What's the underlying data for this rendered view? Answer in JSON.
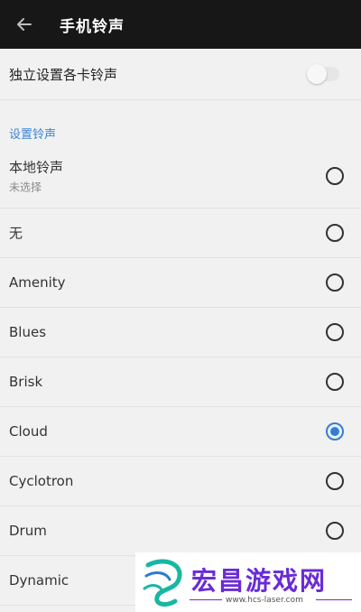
{
  "header": {
    "back_icon": "arrow-left-icon",
    "title": "手机铃声"
  },
  "card_setting": {
    "label": "独立设置各卡铃声",
    "enabled": false
  },
  "section": {
    "title": "设置铃声"
  },
  "ringtones": [
    {
      "title": "本地铃声",
      "subtitle": "未选择",
      "selected": false
    },
    {
      "title": "无",
      "selected": false
    },
    {
      "title": "Amenity",
      "selected": false
    },
    {
      "title": "Blues",
      "selected": false
    },
    {
      "title": "Brisk",
      "selected": false
    },
    {
      "title": "Cloud",
      "selected": true
    },
    {
      "title": "Cyclotron",
      "selected": false
    },
    {
      "title": "Drum",
      "selected": false
    },
    {
      "title": "Dynamic",
      "selected": false
    }
  ],
  "watermark": {
    "text": "宏昌游戏网",
    "url": "www.hcs-laser.com"
  },
  "colors": {
    "header_bg": "#171717",
    "accent": "#2f7fd8",
    "watermark": "#6a2bd6"
  }
}
